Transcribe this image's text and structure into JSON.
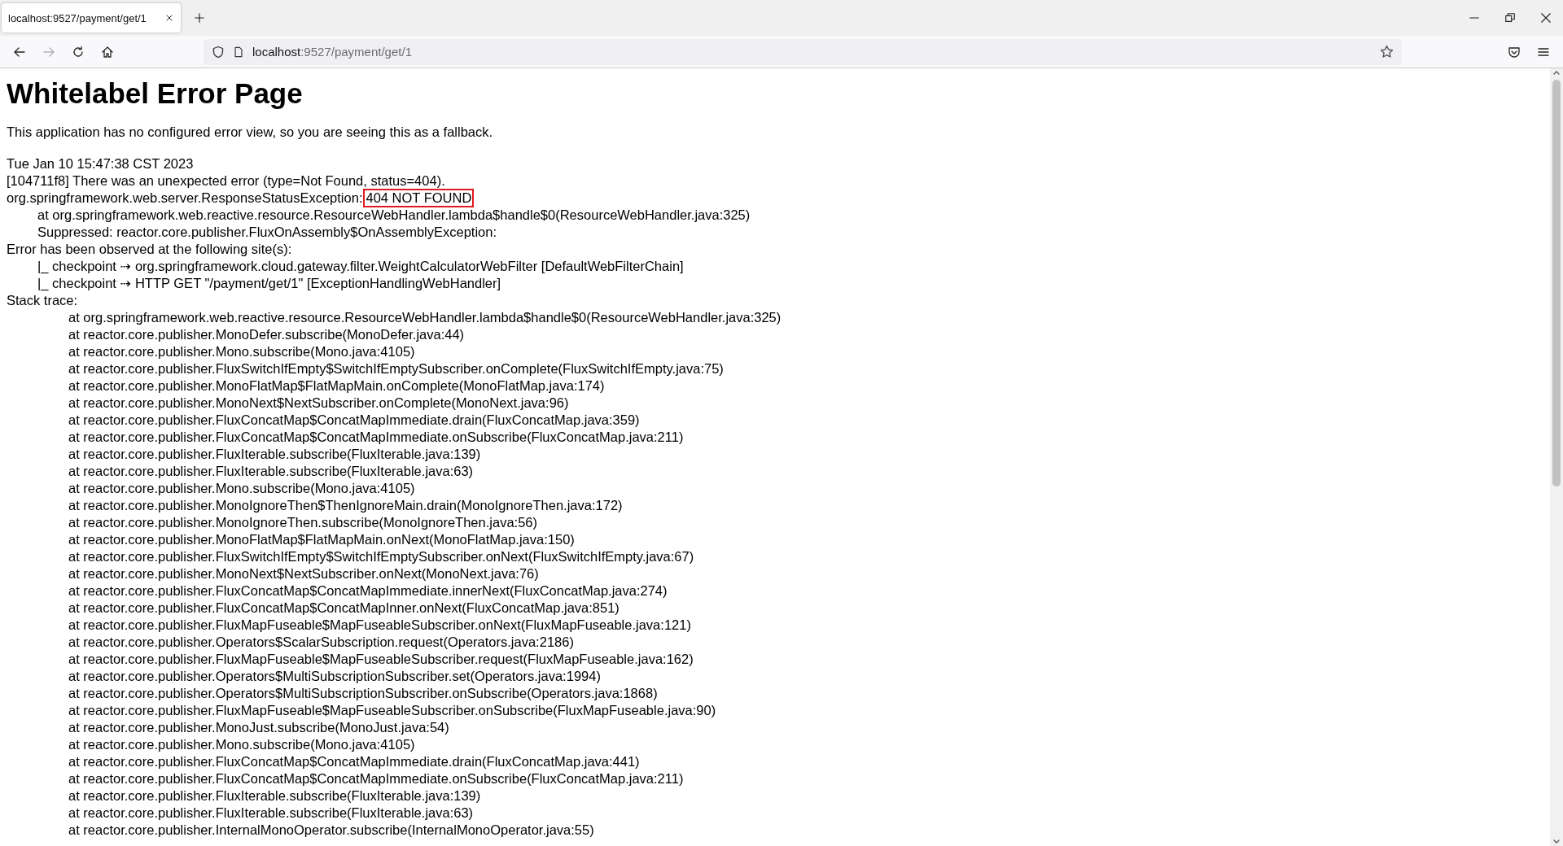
{
  "browser": {
    "tabs": [
      {
        "title": "localhost:9527/payment/get/1",
        "selected": true
      }
    ],
    "nav": {
      "forward_disabled": true
    },
    "address": {
      "host": "localhost",
      "rest": ":9527/payment/get/1"
    }
  },
  "page": {
    "heading": "Whitelabel Error Page",
    "intro": "This application has no configured error view, so you are seeing this as a fallback.",
    "lines": [
      {
        "kind": "plain",
        "text": "Tue Jan 10 15:47:38 CST 2023"
      },
      {
        "kind": "plain",
        "text": "[104711f8] There was an unexpected error (type=Not Found, status=404)."
      },
      {
        "kind": "exception",
        "text": "org.springframework.web.server.ResponseStatusException:",
        "message": "404 NOT FOUND",
        "highlighted": true
      },
      {
        "kind": "indent",
        "text": "at org.springframework.web.reactive.resource.ResourceWebHandler.lambda$handle$0(ResourceWebHandler.java:325)"
      },
      {
        "kind": "indent",
        "text": "Suppressed: reactor.core.publisher.FluxOnAssembly$OnAssemblyException:"
      },
      {
        "kind": "plain",
        "text": "Error has been observed at the following site(s):"
      },
      {
        "kind": "indent",
        "text": "|_ checkpoint ⇢ org.springframework.cloud.gateway.filter.WeightCalculatorWebFilter [DefaultWebFilterChain]"
      },
      {
        "kind": "indent",
        "text": "|_ checkpoint ⇢ HTTP GET \"/payment/get/1\" [ExceptionHandlingWebHandler]"
      },
      {
        "kind": "plain",
        "text": "Stack trace:"
      },
      {
        "kind": "stack",
        "text": "at org.springframework.web.reactive.resource.ResourceWebHandler.lambda$handle$0(ResourceWebHandler.java:325)"
      },
      {
        "kind": "stack",
        "text": "at reactor.core.publisher.MonoDefer.subscribe(MonoDefer.java:44)"
      },
      {
        "kind": "stack",
        "text": "at reactor.core.publisher.Mono.subscribe(Mono.java:4105)"
      },
      {
        "kind": "stack",
        "text": "at reactor.core.publisher.FluxSwitchIfEmpty$SwitchIfEmptySubscriber.onComplete(FluxSwitchIfEmpty.java:75)"
      },
      {
        "kind": "stack",
        "text": "at reactor.core.publisher.MonoFlatMap$FlatMapMain.onComplete(MonoFlatMap.java:174)"
      },
      {
        "kind": "stack",
        "text": "at reactor.core.publisher.MonoNext$NextSubscriber.onComplete(MonoNext.java:96)"
      },
      {
        "kind": "stack",
        "text": "at reactor.core.publisher.FluxConcatMap$ConcatMapImmediate.drain(FluxConcatMap.java:359)"
      },
      {
        "kind": "stack",
        "text": "at reactor.core.publisher.FluxConcatMap$ConcatMapImmediate.onSubscribe(FluxConcatMap.java:211)"
      },
      {
        "kind": "stack",
        "text": "at reactor.core.publisher.FluxIterable.subscribe(FluxIterable.java:139)"
      },
      {
        "kind": "stack",
        "text": "at reactor.core.publisher.FluxIterable.subscribe(FluxIterable.java:63)"
      },
      {
        "kind": "stack",
        "text": "at reactor.core.publisher.Mono.subscribe(Mono.java:4105)"
      },
      {
        "kind": "stack",
        "text": "at reactor.core.publisher.MonoIgnoreThen$ThenIgnoreMain.drain(MonoIgnoreThen.java:172)"
      },
      {
        "kind": "stack",
        "text": "at reactor.core.publisher.MonoIgnoreThen.subscribe(MonoIgnoreThen.java:56)"
      },
      {
        "kind": "stack",
        "text": "at reactor.core.publisher.MonoFlatMap$FlatMapMain.onNext(MonoFlatMap.java:150)"
      },
      {
        "kind": "stack",
        "text": "at reactor.core.publisher.FluxSwitchIfEmpty$SwitchIfEmptySubscriber.onNext(FluxSwitchIfEmpty.java:67)"
      },
      {
        "kind": "stack",
        "text": "at reactor.core.publisher.MonoNext$NextSubscriber.onNext(MonoNext.java:76)"
      },
      {
        "kind": "stack",
        "text": "at reactor.core.publisher.FluxConcatMap$ConcatMapImmediate.innerNext(FluxConcatMap.java:274)"
      },
      {
        "kind": "stack",
        "text": "at reactor.core.publisher.FluxConcatMap$ConcatMapInner.onNext(FluxConcatMap.java:851)"
      },
      {
        "kind": "stack",
        "text": "at reactor.core.publisher.FluxMapFuseable$MapFuseableSubscriber.onNext(FluxMapFuseable.java:121)"
      },
      {
        "kind": "stack",
        "text": "at reactor.core.publisher.Operators$ScalarSubscription.request(Operators.java:2186)"
      },
      {
        "kind": "stack",
        "text": "at reactor.core.publisher.FluxMapFuseable$MapFuseableSubscriber.request(FluxMapFuseable.java:162)"
      },
      {
        "kind": "stack",
        "text": "at reactor.core.publisher.Operators$MultiSubscriptionSubscriber.set(Operators.java:1994)"
      },
      {
        "kind": "stack",
        "text": "at reactor.core.publisher.Operators$MultiSubscriptionSubscriber.onSubscribe(Operators.java:1868)"
      },
      {
        "kind": "stack",
        "text": "at reactor.core.publisher.FluxMapFuseable$MapFuseableSubscriber.onSubscribe(FluxMapFuseable.java:90)"
      },
      {
        "kind": "stack",
        "text": "at reactor.core.publisher.MonoJust.subscribe(MonoJust.java:54)"
      },
      {
        "kind": "stack",
        "text": "at reactor.core.publisher.Mono.subscribe(Mono.java:4105)"
      },
      {
        "kind": "stack",
        "text": "at reactor.core.publisher.FluxConcatMap$ConcatMapImmediate.drain(FluxConcatMap.java:441)"
      },
      {
        "kind": "stack",
        "text": "at reactor.core.publisher.FluxConcatMap$ConcatMapImmediate.onSubscribe(FluxConcatMap.java:211)"
      },
      {
        "kind": "stack",
        "text": "at reactor.core.publisher.FluxIterable.subscribe(FluxIterable.java:139)"
      },
      {
        "kind": "stack",
        "text": "at reactor.core.publisher.FluxIterable.subscribe(FluxIterable.java:63)"
      },
      {
        "kind": "stack",
        "text": "at reactor.core.publisher.InternalMonoOperator.subscribe(InternalMonoOperator.java:55)"
      }
    ]
  }
}
